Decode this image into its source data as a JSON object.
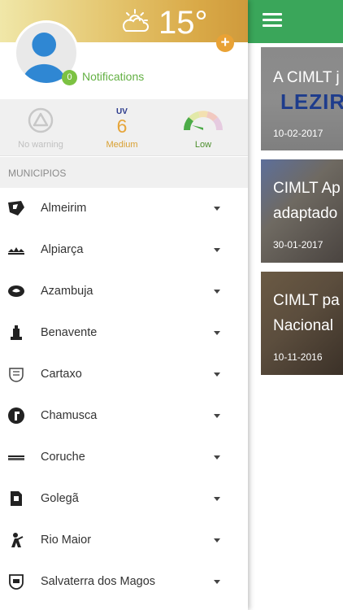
{
  "weather": {
    "temperature": "15°",
    "icon": "cloud-sun-icon"
  },
  "user": {
    "avatar_icon": "person-icon",
    "notification_count": "0",
    "notifications_label": "Notifications"
  },
  "status": {
    "warning": {
      "label": "No warning",
      "icon": "warning-triangle-icon"
    },
    "uv": {
      "title": "UV",
      "value": "6",
      "label": "Medium"
    },
    "air": {
      "label": "Low",
      "icon": "gauge-icon",
      "level": 0.2
    }
  },
  "section": {
    "title": "MUNICIPIOS"
  },
  "municipalities": [
    {
      "name": "Almeirim"
    },
    {
      "name": "Alpiarça"
    },
    {
      "name": "Azambuja"
    },
    {
      "name": "Benavente"
    },
    {
      "name": "Cartaxo"
    },
    {
      "name": "Chamusca"
    },
    {
      "name": "Coruche"
    },
    {
      "name": "Golegã"
    },
    {
      "name": "Rio Maior"
    },
    {
      "name": "Salvaterra dos Magos"
    }
  ],
  "news": [
    {
      "title": "A CIMLT j",
      "date": "10-02-2017",
      "logo_text": "LEZIR"
    },
    {
      "title_line1": "CIMLT Ap",
      "title_line2": "adaptado",
      "date": "30-01-2017"
    },
    {
      "title_line1": "CIMLT pa",
      "title_line2": "Nacional",
      "date": "10-11-2016"
    }
  ],
  "colors": {
    "accent_green": "#3aa65a",
    "notification_green": "#63b043",
    "uv_orange": "#e6a53a",
    "plus_orange": "#e9a235"
  }
}
